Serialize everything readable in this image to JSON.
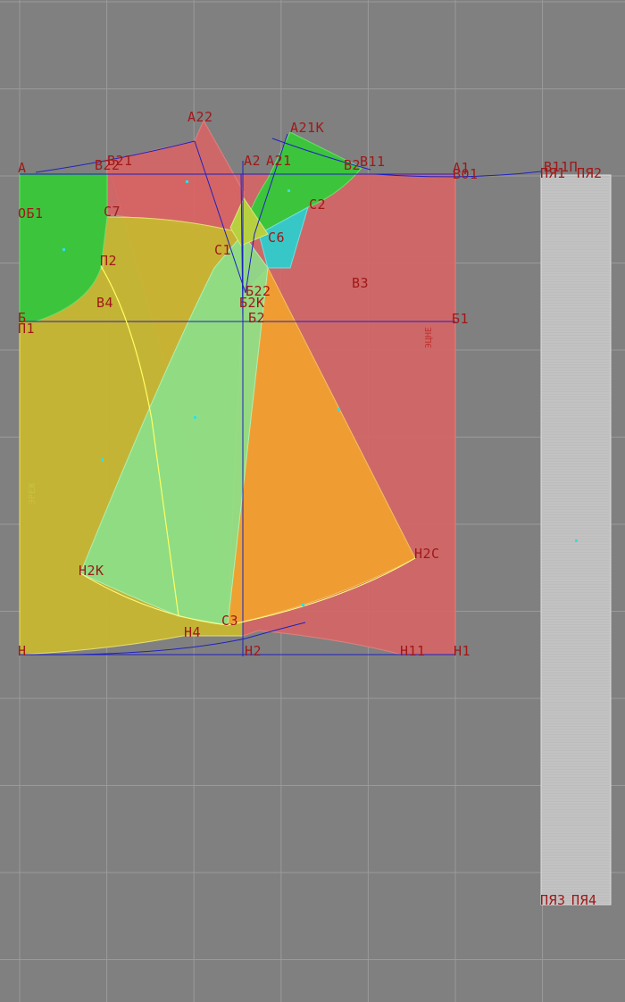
{
  "colors": {
    "background": "#808080",
    "grid": "#9a9a9a",
    "back_piece": "#d66565",
    "front_piece": "#c7b631",
    "green_piece": "#3dc43d",
    "cyan_piece": "#38c7c7",
    "orange_piece": "#f0a030",
    "lightgreen_piece": "#8be08b",
    "belt_piece": "#bdbdbd",
    "construction_line": "#2020c0",
    "label": "#a01818"
  },
  "labels": {
    "A": "A",
    "B21": "B21",
    "B22": "B22",
    "A22": "A22",
    "A21K": "A21K",
    "A2": "A2",
    "A21": "A21",
    "B2": "B2",
    "B11": "B11",
    "A1": "A1",
    "B01": "B01",
    "B11P": "B11П",
    "PYA1": "ПЯ1",
    "PYA2": "ПЯ2",
    "OB1": "ОБ1",
    "C7": "C7",
    "C2": "C2",
    "C6": "C6",
    "C1": "C1",
    "P2": "П2",
    "B4": "B4",
    "B22c": "Б22",
    "B2K": "Б2К",
    "B3": "B3",
    "B": "Б",
    "P1": "П1",
    "B2c": "Б2",
    "B1": "Б1",
    "H2K": "H2K",
    "H2C": "H2C",
    "C3": "C3",
    "H4": "H4",
    "H": "H",
    "H2": "H2",
    "H11": "H11",
    "H1": "H1",
    "PYA3": "ПЯ3",
    "PYA4": "ПЯ4"
  },
  "vertical_labels": {
    "back_grain": "ЭЦНЕ",
    "front_grain": "ЭРЕЖ"
  }
}
